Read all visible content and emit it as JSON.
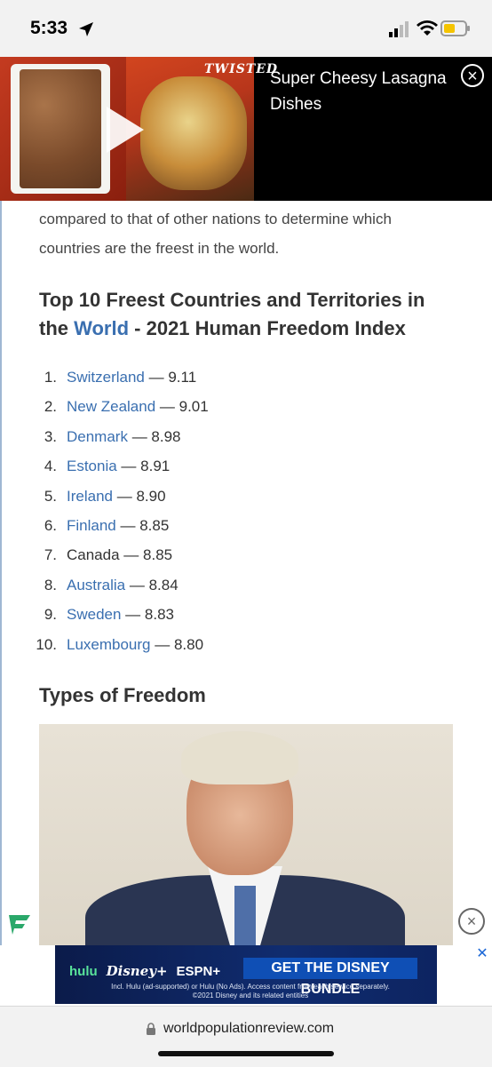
{
  "status_bar": {
    "time": "5:33"
  },
  "video_ad": {
    "logo": "TWISTED",
    "title": "Super Cheesy Lasagna Dishes",
    "close": "×"
  },
  "article": {
    "intro": "compared to that of other nations to determine which countries are the freest in the world.",
    "heading_part1": "Top 10 Freest Countries and Territories in the ",
    "heading_link": "World",
    "heading_part2": " - 2021 Human Freedom Index",
    "rankings": [
      {
        "rank": "1.",
        "country": "Switzerland",
        "score": "9.11"
      },
      {
        "rank": "2.",
        "country": "New Zealand",
        "score": "9.01"
      },
      {
        "rank": "3.",
        "country": "Denmark",
        "score": "8.98"
      },
      {
        "rank": "4.",
        "country": "Estonia",
        "score": "8.91"
      },
      {
        "rank": "5.",
        "country": "Ireland",
        "score": "8.90"
      },
      {
        "rank": "6.",
        "country": "Finland",
        "score": "8.85"
      },
      {
        "rank": "7.",
        "country": "Canada",
        "score": "8.85"
      },
      {
        "rank": "8.",
        "country": "Australia",
        "score": "8.84"
      },
      {
        "rank": "9.",
        "country": "Sweden",
        "score": "8.83"
      },
      {
        "rank": "10.",
        "country": "Luxembourg",
        "score": "8.80"
      }
    ],
    "separator": " — ",
    "subheading": "Types of Freedom"
  },
  "side_close": "×",
  "banner_ad": {
    "hulu": "hulu",
    "disney": "Disney+",
    "espn": "ESPN+",
    "cta": "GET THE DISNEY BUNDLE",
    "fine_print_1": "Incl. Hulu (ad-supported) or Hulu (No Ads). Access content from each service separately.",
    "fine_print_2": "©2021 Disney and its related entities",
    "close": "✕"
  },
  "url_bar": {
    "url": "worldpopulationreview.com"
  },
  "colors": {
    "link": "#3a6fb0",
    "text": "#333333",
    "ad_background": "#000000",
    "banner_cta": "#0f4fb5"
  },
  "icons": [
    "location-arrow-icon",
    "cellular-signal-icon",
    "wifi-icon",
    "battery-icon",
    "play-icon",
    "close-icon",
    "lock-icon",
    "app-logo-icon"
  ]
}
